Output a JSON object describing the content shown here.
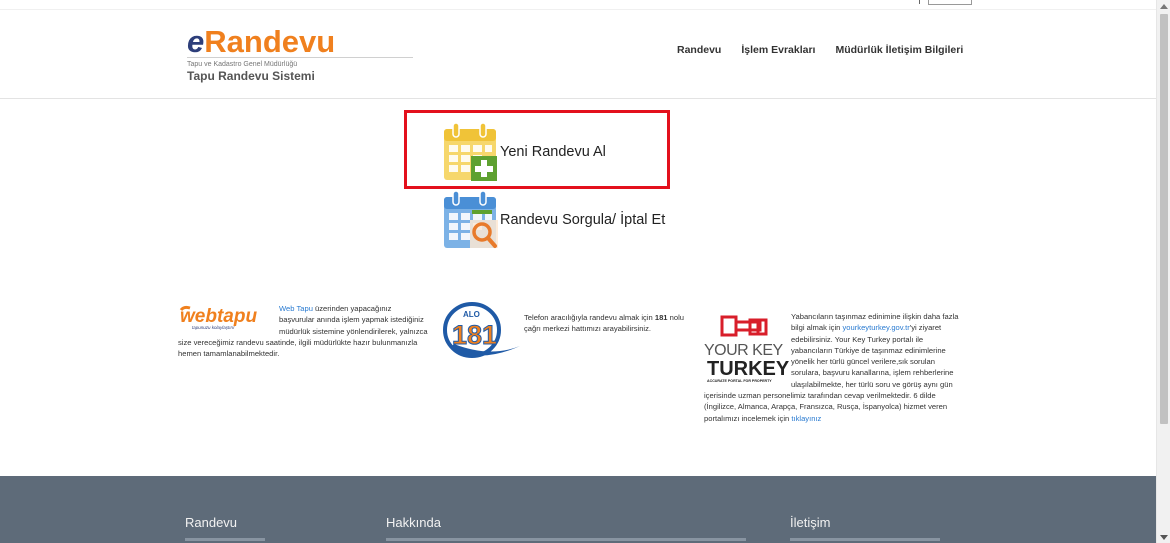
{
  "header": {
    "logo": {
      "brand_e": "e",
      "brand_name": "Randevu",
      "subtitle": "Tapu ve Kadastro Genel Müdürlüğü",
      "system_name": "Tapu Randevu Sistemi"
    },
    "nav": [
      {
        "label": "Randevu"
      },
      {
        "label": "İşlem Evrakları"
      },
      {
        "label": "Müdürlük İletişim Bilgileri"
      }
    ]
  },
  "main": {
    "new_appointment": {
      "label": "Yeni Randevu Al",
      "icon": "calendar-plus-icon"
    },
    "query_appointment": {
      "label": "Randevu Sorgula/ İptal Et",
      "icon": "calendar-search-icon"
    }
  },
  "info": {
    "webtapu": {
      "logo_text": "webtapu",
      "logo_tagline": "tapunuzu kolaylaştırır",
      "link": "Web Tapu",
      "text": " üzerinden yapacağınız başvurular anında işlem yapmak istediğiniz müdürlük sistemine yönlendirilerek, yalnızca size vereceğimiz randevu saatinde, ilgili müdürlükte hazır bulunmanızla hemen tamamlanabilmektedir."
    },
    "alo181": {
      "logo_top": "ALO",
      "logo_number": "181",
      "text_before": "Telefon aracılığıyla randevu almak için ",
      "number": "181",
      "text_after": " nolu çağrı merkezi hattımızı arayabilirsiniz."
    },
    "yourkey": {
      "logo_line1": "YOUR KEY",
      "logo_line2": "TURKEY",
      "logo_tagline": "ACCURATE PORTAL FOR PROPERTY",
      "text1": "Yabancıların taşınmaz edinimine ilişkin daha fazla bilgi almak için ",
      "link1": "yourkeyturkey.gov.tr",
      "text2": "'yi ziyaret edebilirsiniz. Your Key Turkey portalı ile yabancıların Türkiye de taşınmaz edinimlerine yönelik her türlü güncel verilere,sık sorulan sorulara, başvuru kanallarına, işlem rehberlerine ulaşılabilmekte, her türlü soru ve görüş aynı gün içerisinde uzman personelimiz tarafından cevap verilmektedir. 6 dilde (İngilizce, Almanca, Arapça, Fransızca, Rusça, İspanyolca) hizmet veren portalımızı incelemek için ",
      "link2": "tıklayınız"
    }
  },
  "footer": {
    "col1": "Randevu",
    "col2": "Hakkında",
    "col3": "İletişim"
  },
  "colors": {
    "brand_orange": "#f0801e",
    "brand_navy": "#2d3e7a",
    "highlight_red": "#e3101c",
    "footer_bg": "#5e6b79",
    "link_blue": "#2a7bd1"
  }
}
